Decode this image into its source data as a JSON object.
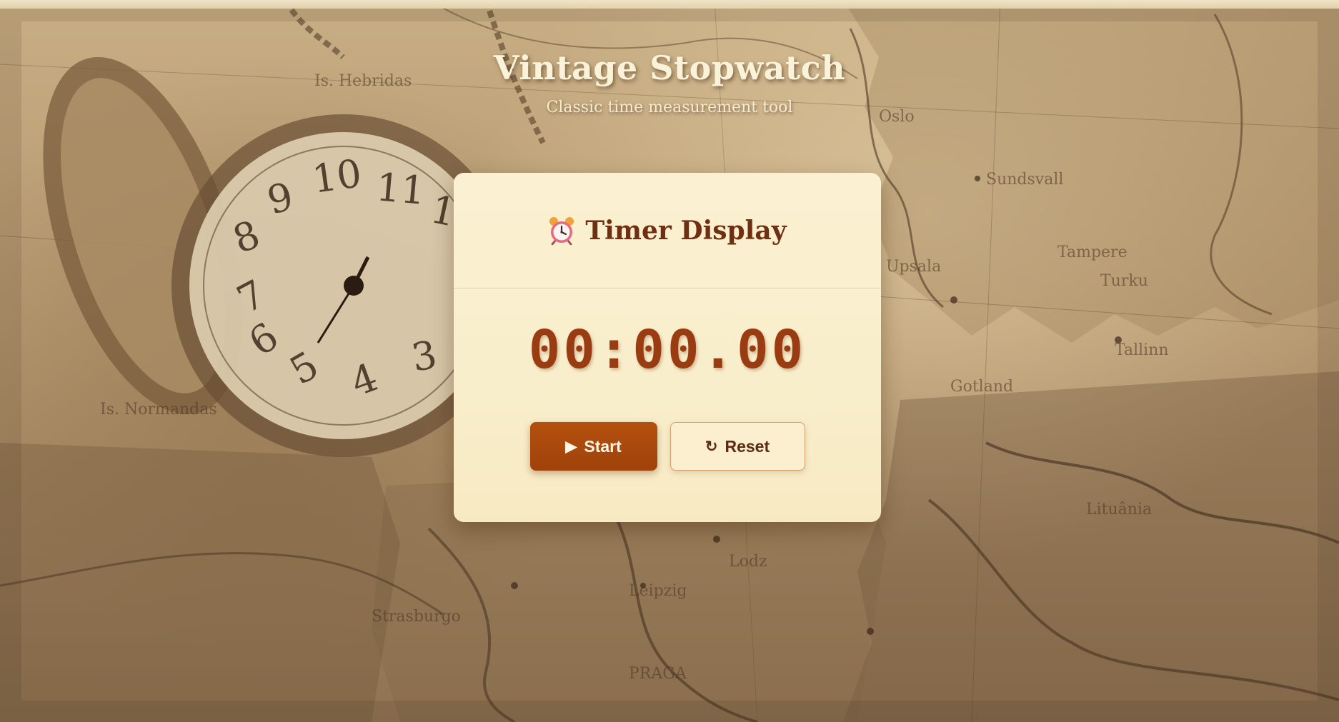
{
  "header": {
    "title": "Vintage Stopwatch",
    "subtitle": "Classic time measurement tool"
  },
  "card": {
    "title": "Timer Display",
    "icon": "alarm-clock-icon"
  },
  "timer": {
    "display": "00:00.00"
  },
  "controls": {
    "start_label": "Start",
    "start_icon": "▶",
    "reset_label": "Reset",
    "reset_icon": "↻"
  },
  "colors": {
    "accent": "#a7450c",
    "time_text": "#9a3c11",
    "card_bg": "#faefcd",
    "title_text": "#6e2f12"
  }
}
